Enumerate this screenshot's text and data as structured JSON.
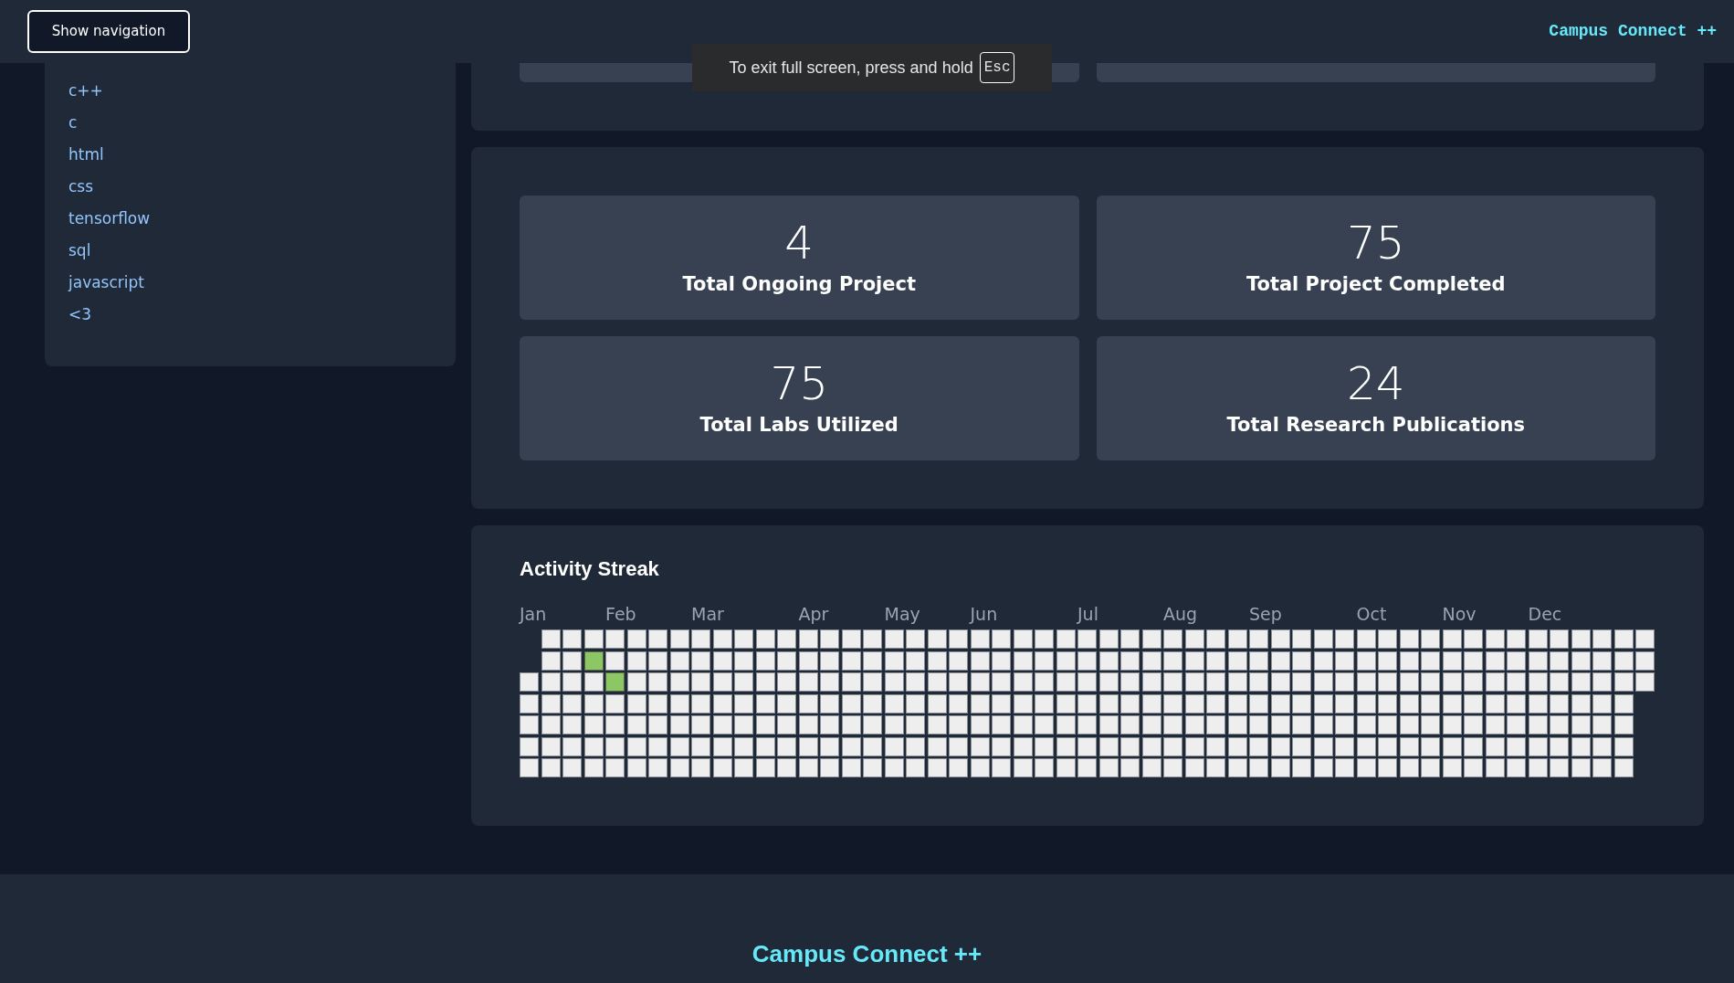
{
  "header": {
    "nav_button": "Show navigation",
    "brand": "Campus Connect ++"
  },
  "fullscreen_notice": {
    "message": "To exit full screen, press and hold",
    "key": "Esc"
  },
  "sidebar": {
    "items": [
      "c++",
      "c",
      "html",
      "css",
      "tensorflow",
      "sql",
      "javascript",
      "<3"
    ]
  },
  "stats": [
    {
      "value": "4",
      "label": "Total Ongoing Project"
    },
    {
      "value": "75",
      "label": "Total Project Completed"
    },
    {
      "value": "75",
      "label": "Total Labs Utilized"
    },
    {
      "value": "24",
      "label": "Total Research Publications"
    }
  ],
  "activity": {
    "title": "Activity Streak",
    "weeks": [
      {
        "month": "Jan",
        "kind": "start",
        "days": [
          false,
          false,
          false,
          false,
          false
        ]
      },
      {
        "days": [
          false,
          false,
          false,
          false,
          false,
          false,
          false
        ]
      },
      {
        "days": [
          false,
          false,
          false,
          false,
          false,
          false,
          false
        ]
      },
      {
        "days": [
          false,
          true,
          false,
          false,
          false,
          false,
          false
        ]
      },
      {
        "month": "Feb",
        "days": [
          false,
          false,
          true,
          false,
          false,
          false,
          false
        ]
      },
      {
        "days": [
          false,
          false,
          false,
          false,
          false,
          false,
          false
        ]
      },
      {
        "days": [
          false,
          false,
          false,
          false,
          false,
          false,
          false
        ]
      },
      {
        "days": [
          false,
          false,
          false,
          false,
          false,
          false,
          false
        ]
      },
      {
        "month": "Mar",
        "days": [
          false,
          false,
          false,
          false,
          false,
          false,
          false
        ]
      },
      {
        "days": [
          false,
          false,
          false,
          false,
          false,
          false,
          false
        ]
      },
      {
        "days": [
          false,
          false,
          false,
          false,
          false,
          false,
          false
        ]
      },
      {
        "days": [
          false,
          false,
          false,
          false,
          false,
          false,
          false
        ]
      },
      {
        "days": [
          false,
          false,
          false,
          false,
          false,
          false,
          false
        ]
      },
      {
        "month": "Apr",
        "days": [
          false,
          false,
          false,
          false,
          false,
          false,
          false
        ]
      },
      {
        "days": [
          false,
          false,
          false,
          false,
          false,
          false,
          false
        ]
      },
      {
        "days": [
          false,
          false,
          false,
          false,
          false,
          false,
          false
        ]
      },
      {
        "days": [
          false,
          false,
          false,
          false,
          false,
          false,
          false
        ]
      },
      {
        "month": "May",
        "days": [
          false,
          false,
          false,
          false,
          false,
          false,
          false
        ]
      },
      {
        "days": [
          false,
          false,
          false,
          false,
          false,
          false,
          false
        ]
      },
      {
        "days": [
          false,
          false,
          false,
          false,
          false,
          false,
          false
        ]
      },
      {
        "days": [
          false,
          false,
          false,
          false,
          false,
          false,
          false
        ]
      },
      {
        "month": "Jun",
        "days": [
          false,
          false,
          false,
          false,
          false,
          false,
          false
        ]
      },
      {
        "days": [
          false,
          false,
          false,
          false,
          false,
          false,
          false
        ]
      },
      {
        "days": [
          false,
          false,
          false,
          false,
          false,
          false,
          false
        ]
      },
      {
        "days": [
          false,
          false,
          false,
          false,
          false,
          false,
          false
        ]
      },
      {
        "days": [
          false,
          false,
          false,
          false,
          false,
          false,
          false
        ]
      },
      {
        "month": "Jul",
        "days": [
          false,
          false,
          false,
          false,
          false,
          false,
          false
        ]
      },
      {
        "days": [
          false,
          false,
          false,
          false,
          false,
          false,
          false
        ]
      },
      {
        "days": [
          false,
          false,
          false,
          false,
          false,
          false,
          false
        ]
      },
      {
        "days": [
          false,
          false,
          false,
          false,
          false,
          false,
          false
        ]
      },
      {
        "month": "Aug",
        "days": [
          false,
          false,
          false,
          false,
          false,
          false,
          false
        ]
      },
      {
        "days": [
          false,
          false,
          false,
          false,
          false,
          false,
          false
        ]
      },
      {
        "days": [
          false,
          false,
          false,
          false,
          false,
          false,
          false
        ]
      },
      {
        "days": [
          false,
          false,
          false,
          false,
          false,
          false,
          false
        ]
      },
      {
        "month": "Sep",
        "days": [
          false,
          false,
          false,
          false,
          false,
          false,
          false
        ]
      },
      {
        "days": [
          false,
          false,
          false,
          false,
          false,
          false,
          false
        ]
      },
      {
        "days": [
          false,
          false,
          false,
          false,
          false,
          false,
          false
        ]
      },
      {
        "days": [
          false,
          false,
          false,
          false,
          false,
          false,
          false
        ]
      },
      {
        "days": [
          false,
          false,
          false,
          false,
          false,
          false,
          false
        ]
      },
      {
        "month": "Oct",
        "days": [
          false,
          false,
          false,
          false,
          false,
          false,
          false
        ]
      },
      {
        "days": [
          false,
          false,
          false,
          false,
          false,
          false,
          false
        ]
      },
      {
        "days": [
          false,
          false,
          false,
          false,
          false,
          false,
          false
        ]
      },
      {
        "days": [
          false,
          false,
          false,
          false,
          false,
          false,
          false
        ]
      },
      {
        "month": "Nov",
        "days": [
          false,
          false,
          false,
          false,
          false,
          false,
          false
        ]
      },
      {
        "days": [
          false,
          false,
          false,
          false,
          false,
          false,
          false
        ]
      },
      {
        "days": [
          false,
          false,
          false,
          false,
          false,
          false,
          false
        ]
      },
      {
        "days": [
          false,
          false,
          false,
          false,
          false,
          false,
          false
        ]
      },
      {
        "month": "Dec",
        "days": [
          false,
          false,
          false,
          false,
          false,
          false,
          false
        ]
      },
      {
        "days": [
          false,
          false,
          false,
          false,
          false,
          false,
          false
        ]
      },
      {
        "days": [
          false,
          false,
          false,
          false,
          false,
          false,
          false
        ]
      },
      {
        "days": [
          false,
          false,
          false,
          false,
          false,
          false,
          false
        ]
      },
      {
        "days": [
          false,
          false,
          false,
          false,
          false,
          false,
          false
        ]
      },
      {
        "kind": "end",
        "days": [
          false,
          false,
          false
        ]
      }
    ]
  },
  "footer": {
    "brand": "Campus Connect ++"
  }
}
